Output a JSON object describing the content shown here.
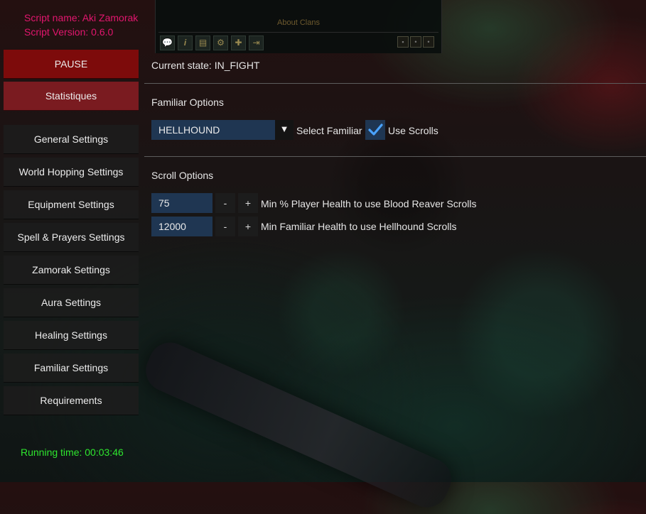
{
  "script_info": {
    "name": "Script name: Aki Zamorak",
    "version": "Script Version: 0.6.0"
  },
  "game_window": {
    "label": "About Clans",
    "icons": [
      "chat-icon",
      "info-icon",
      "folder-icon",
      "gear-icon",
      "add-member-icon",
      "leave-icon"
    ]
  },
  "sidebar": {
    "items": [
      {
        "label": "PAUSE"
      },
      {
        "label": "Statistiques"
      },
      {
        "label": "General Settings"
      },
      {
        "label": "World Hopping Settings"
      },
      {
        "label": "Equipment Settings"
      },
      {
        "label": "Spell & Prayers Settings"
      },
      {
        "label": "Zamorak Settings"
      },
      {
        "label": "Aura Settings"
      },
      {
        "label": "Healing Settings"
      },
      {
        "label": "Familiar Settings"
      },
      {
        "label": "Requirements"
      }
    ]
  },
  "running_time": "Running time: 00:03:46",
  "main": {
    "current_state": "Current state: IN_FIGHT",
    "familiar_options": {
      "title": "Familiar Options",
      "selected_familiar": "HELLHOUND",
      "dropdown_arrow": "▼",
      "select_label": "Select Familiar",
      "use_scrolls_label": "Use Scrolls",
      "use_scrolls_checked": true
    },
    "scroll_options": {
      "title": "Scroll Options",
      "rows": [
        {
          "value": "75",
          "minus": "-",
          "plus": "+",
          "label": "Min % Player Health to use Blood Reaver Scrolls"
        },
        {
          "value": "12000",
          "minus": "-",
          "plus": "+",
          "label": "Min Familiar Health to use Hellhound Scrolls"
        }
      ]
    }
  },
  "colors": {
    "script_info": "#e2166e",
    "running_time": "#2ee62e",
    "pause_bg": "#7d0b0b",
    "stats_bg": "#7a1b20",
    "field_bg": "#1f3652",
    "check": "#4aa3ff"
  }
}
